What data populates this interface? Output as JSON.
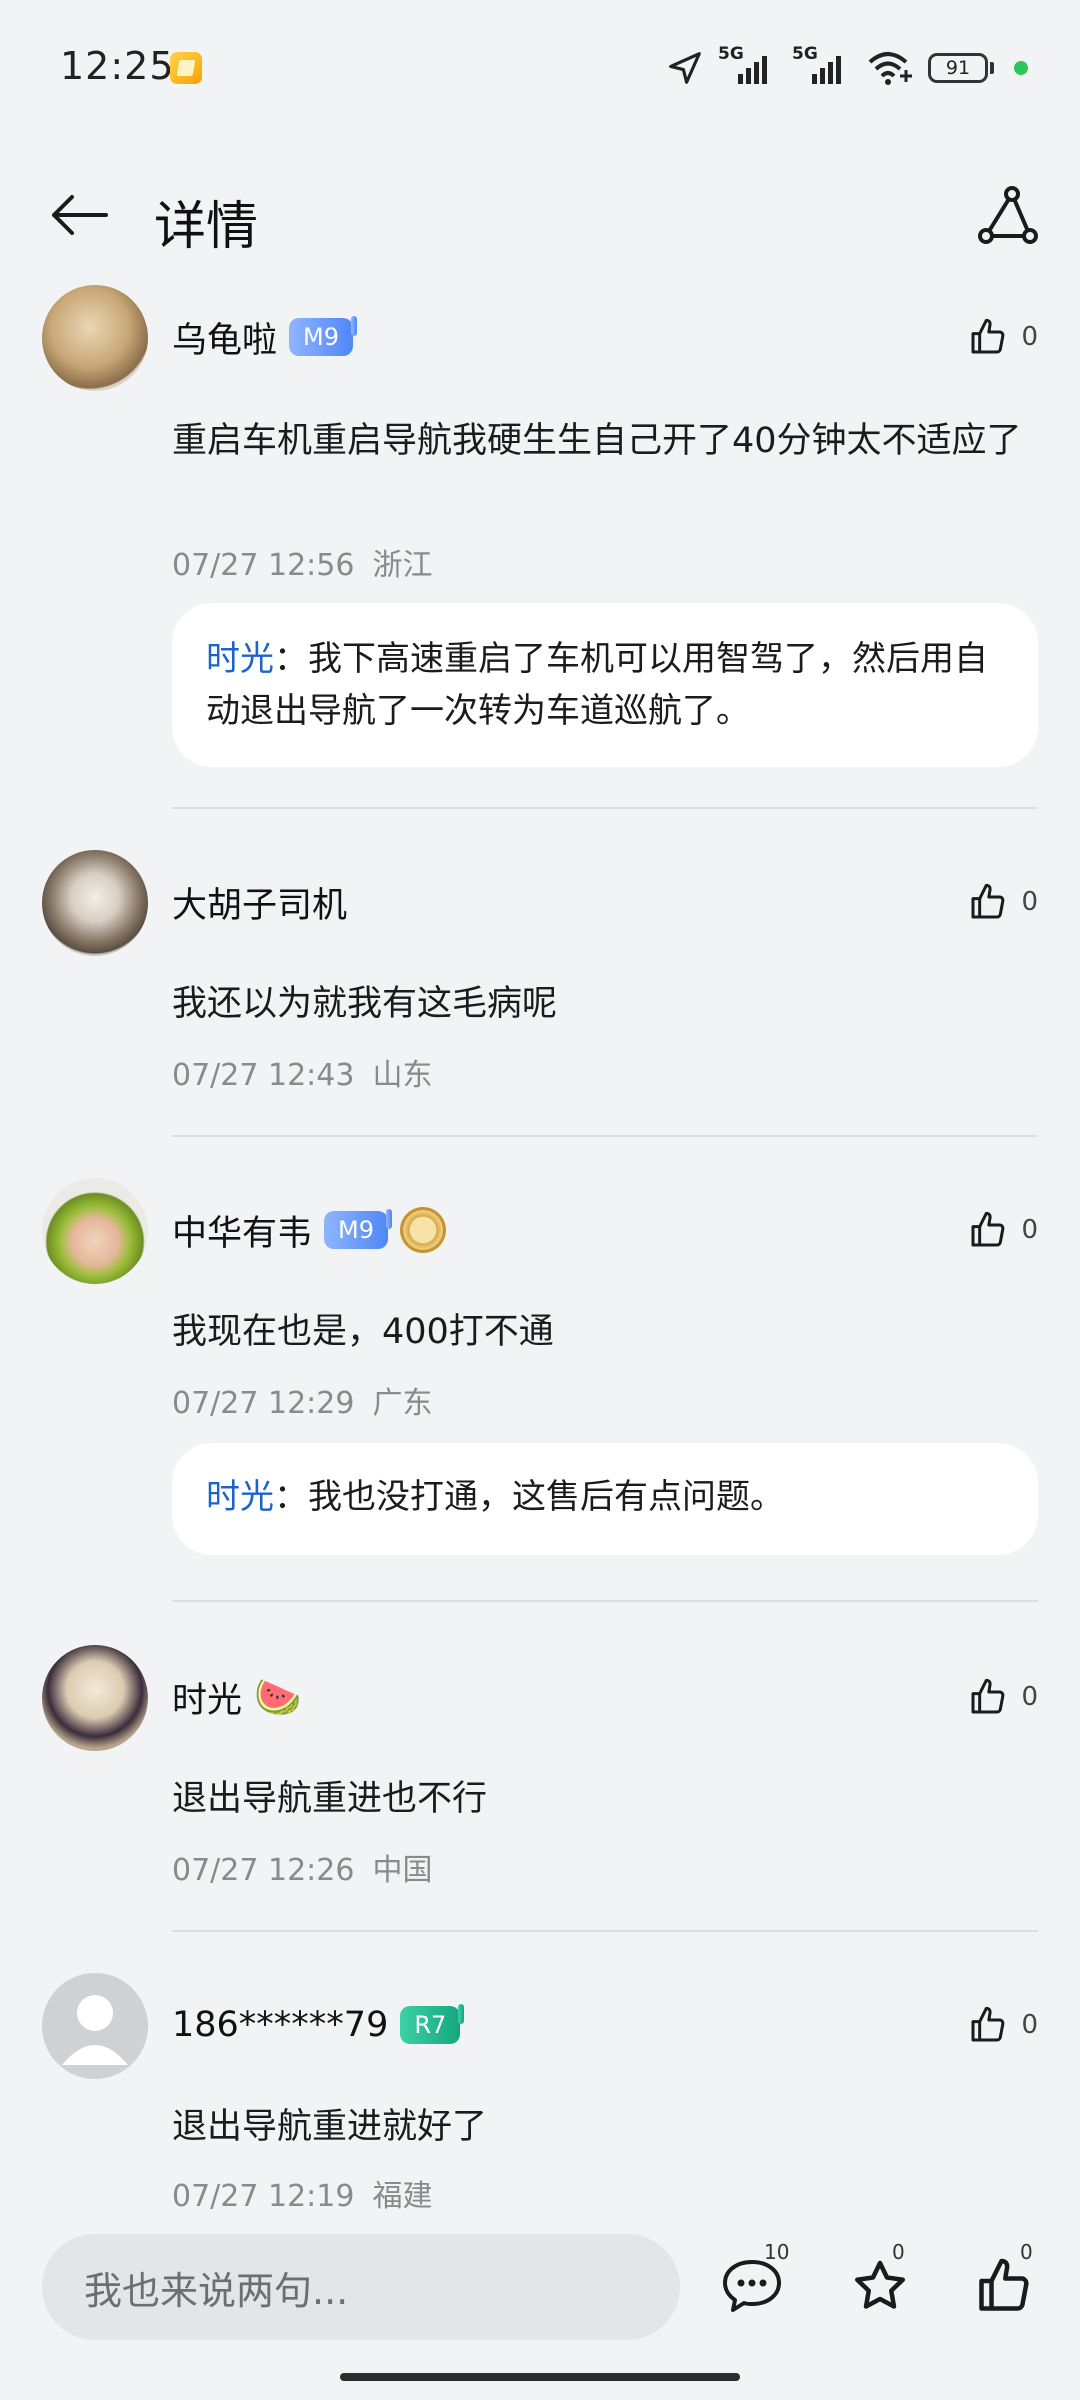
{
  "status_bar": {
    "time": "12:25",
    "network_1": "5G",
    "network_2": "5G",
    "battery": "91",
    "icons": [
      "location-icon",
      "signal-icon",
      "signal-icon",
      "wifi-icon",
      "battery-icon"
    ]
  },
  "nav": {
    "title": "详情",
    "back_icon": "arrow-left-icon",
    "share_icon": "share-icon"
  },
  "comments": [
    {
      "user": "乌龟啦",
      "badge": "M9",
      "likes": "0",
      "text": "重启车机重启导航我硬生生自己开了40分钟太不适应了",
      "date": "07/27 12:56",
      "location": "浙江",
      "reply": {
        "author": "时光",
        "sep": "：",
        "text": "我下高速重启了车机可以用智驾了，然后用自动退出导航了一次转为车道巡航了。"
      }
    },
    {
      "user": "大胡子司机",
      "likes": "0",
      "text": "我还以为就我有这毛病呢",
      "date": "07/27 12:43",
      "location": "山东"
    },
    {
      "user": "中华有韦",
      "badge": "M9",
      "likes": "0",
      "text": "我现在也是，400打不通",
      "date": "07/27 12:29",
      "location": "广东",
      "reply": {
        "author": "时光",
        "sep": "：",
        "text": "我也没打通，这售后有点问题。"
      }
    },
    {
      "user": "时光",
      "emoji": "🍉",
      "likes": "0",
      "text": "退出导航重进也不行",
      "date": "07/27 12:26",
      "location": "中国"
    },
    {
      "user": "186******79",
      "badge": "R7",
      "likes": "0",
      "text": "退出导航重进就好了",
      "date": "07/27 12:19",
      "location": "福建"
    }
  ],
  "bottom_bar": {
    "input_placeholder": "我也来说两句...",
    "comments_count": "10",
    "favorites_count": "0",
    "likes_count": "0"
  },
  "colors": {
    "background": "#f1f3f5",
    "reply_author": "#1e63c9",
    "badge_m9": "#4f87f6",
    "badge_r7": "#14a67e"
  }
}
